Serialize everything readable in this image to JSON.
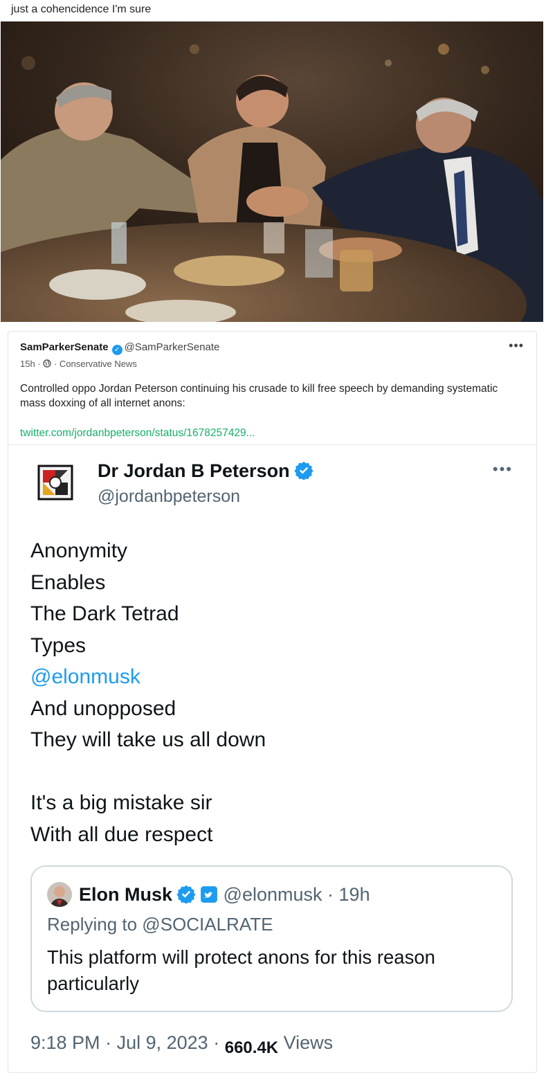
{
  "caption": "just a cohencidence I'm sure",
  "post": {
    "author": "SamParkerSenate",
    "handle": "@SamParkerSenate",
    "time": "15h",
    "community": "Conservative News",
    "menu": "•••",
    "text": "Controlled oppo Jordan Peterson continuing his crusade to kill free speech by demanding systematic mass doxxing of all internet anons:",
    "link": "twitter.com/jordanbpeterson/status/1678257429..."
  },
  "tweet": {
    "name": "Dr Jordan B Peterson",
    "handle": "@jordanbpeterson",
    "menu": "•••",
    "lines": [
      "Anonymity",
      "Enables",
      "The Dark Tetrad",
      "Types",
      "@elonmusk",
      "And unopposed",
      "They will take us all down",
      "",
      "It's a big mistake sir",
      "With all due respect"
    ],
    "quote": {
      "name": "Elon Musk",
      "handle": "@elonmusk",
      "time": "19h",
      "replying_to": "Replying to @SOCIALRATE",
      "text": "This platform will protect anons for this reason particularly"
    },
    "footer": {
      "time": "9:18 PM",
      "date": "Jul 9, 2023",
      "views": "660.4K",
      "views_label": "Views"
    }
  },
  "colors": {
    "link_green": "#15b06a",
    "twitter_blue": "#1d9bf0",
    "muted": "#536471"
  },
  "icons": [
    "verified-badge-icon",
    "globe-icon",
    "more-options-icon",
    "twitter-bird-icon"
  ]
}
